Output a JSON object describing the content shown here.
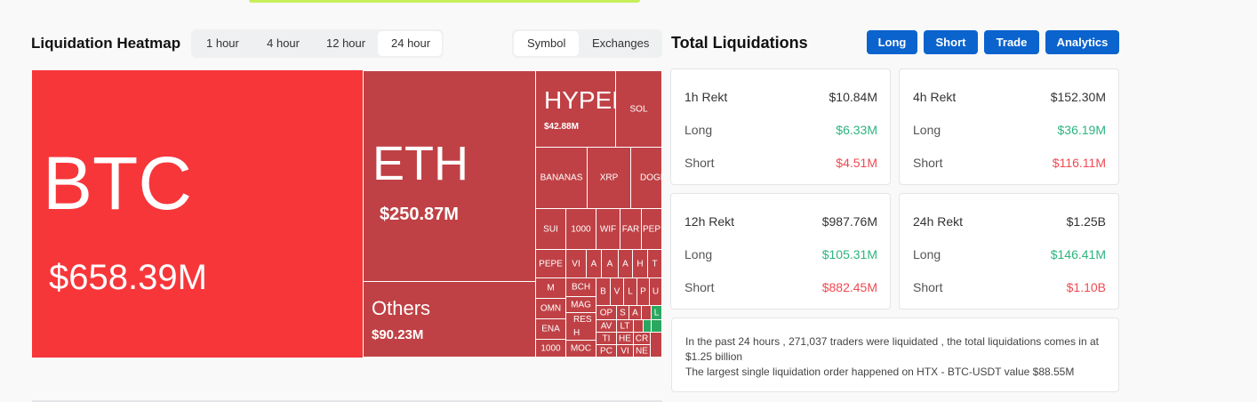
{
  "heatmap": {
    "title": "Liquidation Heatmap",
    "time_tabs": [
      "1 hour",
      "4 hour",
      "12 hour",
      "24 hour"
    ],
    "active_time_tab": "24 hour",
    "group_tabs": [
      "Symbol",
      "Exchanges"
    ],
    "active_group_tab": "Symbol",
    "cells": {
      "btc": {
        "name": "BTC",
        "value": "$658.39M"
      },
      "eth": {
        "name": "ETH",
        "value": "$250.87M"
      },
      "others": {
        "name": "Others",
        "value": "$90.23M"
      },
      "hyper": {
        "name": "HYPER",
        "value": "$42.88M"
      },
      "sol": "SOL",
      "bananas": "BANANAS",
      "xrp": "XRP",
      "doge": "DOGE",
      "sui": "SUI",
      "t1000a": "1000",
      "wif": "WIF",
      "far": "FAR",
      "pep": "PEP",
      "pepe": "PEPE",
      "vi": "VI",
      "a1": "A",
      "a2": "A",
      "a3": "A",
      "h1": "H",
      "t1": "T",
      "m": "M",
      "bch": "BCH",
      "b": "B",
      "v1": "V",
      "l1": "L",
      "p1": "P",
      "u1": "U",
      "omn": "OMN",
      "mag": "MAG",
      "op": "OP",
      "s1": "S",
      "a4": "A",
      "res": "RES",
      "av": "AV",
      "l2": "L",
      "ena": "ENA",
      "h2": "H",
      "lt": "LT",
      "ti": "TI",
      "he": "HE",
      "cr": "CR",
      "t1000b": "1000",
      "moc": "MOC",
      "pc": "PC",
      "vi2": "VI",
      "ne": "NE"
    }
  },
  "totals": {
    "title": "Total Liquidations",
    "buttons": [
      "Long",
      "Short",
      "Trade",
      "Analytics"
    ],
    "cards": [
      {
        "label": "1h Rekt",
        "total": "$10.84M",
        "long_label": "Long",
        "long": "$6.33M",
        "short_label": "Short",
        "short": "$4.51M"
      },
      {
        "label": "4h Rekt",
        "total": "$152.30M",
        "long_label": "Long",
        "long": "$36.19M",
        "short_label": "Short",
        "short": "$116.11M"
      },
      {
        "label": "12h Rekt",
        "total": "$987.76M",
        "long_label": "Long",
        "long": "$105.31M",
        "short_label": "Short",
        "short": "$882.45M"
      },
      {
        "label": "24h Rekt",
        "total": "$1.25B",
        "long_label": "Long",
        "long": "$146.41M",
        "short_label": "Short",
        "short": "$1.10B"
      }
    ],
    "summary_line1": "In the past 24 hours , 271,037 traders were liquidated , the total liquidations comes in at $1.25 billion",
    "summary_line2": "The largest single liquidation order happened on HTX - BTC-USDT value $88.55M"
  },
  "colors": {
    "btc": "#f7363a",
    "cell": "#bf4145",
    "green_cell": "#2aa860",
    "accent_button": "#0b63ce",
    "long_value": "#2db47f",
    "short_value": "#ef4a52"
  }
}
